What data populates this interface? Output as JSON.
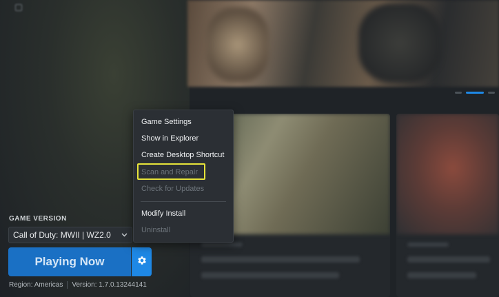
{
  "game_version": {
    "label": "GAME VERSION",
    "selected": "Call of Duty: MWII | WZ2.0"
  },
  "play_button": {
    "label": "Playing Now"
  },
  "footer": {
    "region": "Region: Americas",
    "version": "Version: 1.7.0.13244141"
  },
  "context_menu": {
    "items": [
      {
        "label": "Game Settings",
        "disabled": false
      },
      {
        "label": "Show in Explorer",
        "disabled": false
      },
      {
        "label": "Create Desktop Shortcut",
        "disabled": false
      },
      {
        "label": "Scan and Repair",
        "disabled": true,
        "highlighted": true
      },
      {
        "label": "Check for Updates",
        "disabled": true
      },
      {
        "label": "Modify Install",
        "disabled": false
      },
      {
        "label": "Uninstall",
        "disabled": true
      }
    ]
  },
  "colors": {
    "accent": "#1e88e5",
    "play_button": "#1a70c4",
    "highlight": "#e7e43a"
  },
  "icons": {
    "gear": "gear-icon",
    "chevron": "chevron-down-icon"
  }
}
